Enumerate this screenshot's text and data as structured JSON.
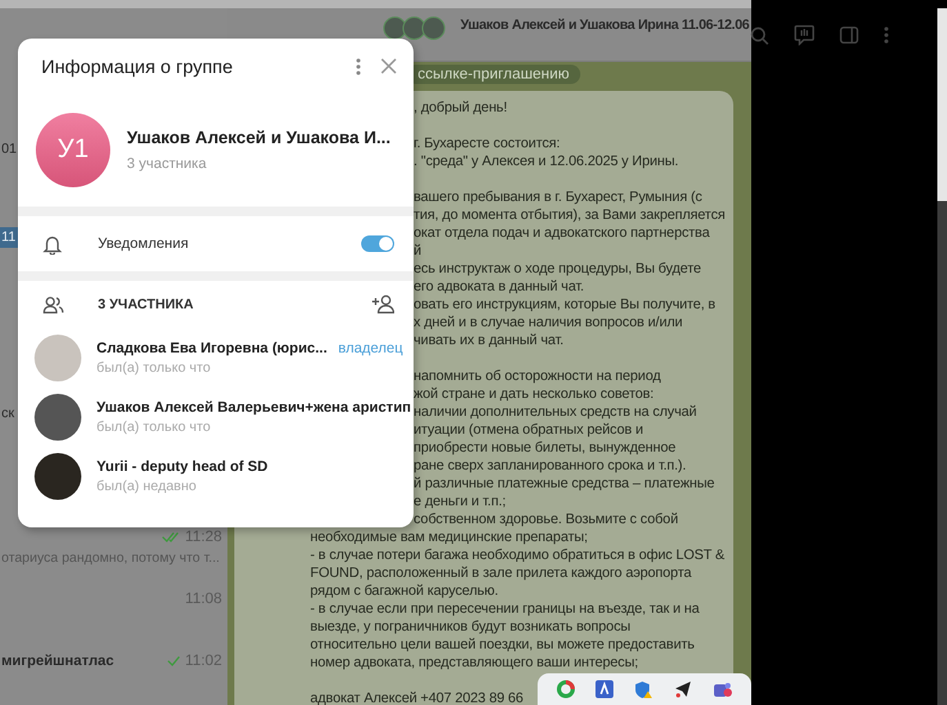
{
  "chat_list": {
    "edge_fragments": [
      {
        "text": "01",
        "selected": false
      },
      {
        "text": "11",
        "selected": true
      },
      {
        "text": "ск",
        "selected": false
      }
    ],
    "rows": [
      {
        "time": "11:28",
        "preview": "отариуса рандомно, потому что т...",
        "tick": true,
        "read": true
      },
      {
        "time": "11:08",
        "tick": false
      },
      {
        "name": "мигрейшнатлас",
        "time": "11:02",
        "tick": true,
        "read": false
      }
    ]
  },
  "chat": {
    "title": "Ушаков Алексей и Ушакова Ирина 11.06-12.06",
    "service_message": "ссылке-приглашению",
    "paragraphs_beside_panel": [
      [
        ", добрый день!"
      ],
      [
        "г. Бухаресте состоится:",
        ". \"среда\"  у Алексея и 12.06.2025 у Ирины."
      ],
      [
        "вашего пребывания в г. Бухарест, Румыния (с",
        "тия, до момента отбытия), за Вами закрепляется",
        "окат отдела подач и адвокатского партнерства",
        "й",
        "есь инструктаж о ходе процедуры, Вы будете",
        "его адвоката в данный чат.",
        "овать его инструкциям, которые Вы получите, в",
        "х дней и в случае наличия вопросов и/или",
        "чивать их в данный чат."
      ],
      [
        "напомнить об осторожности на период",
        "жой стране и дать несколько советов:",
        "наличии дополнительных средств на случай",
        "итуации (отмена обратных рейсов и",
        "приобрести новые билеты, вынужденное",
        "ране сверх запланированного срока и т.п.).",
        "й различные платежные средства – платежные",
        "е деньги и т.п.;",
        "собственном здоровье. Возьмите с собой"
      ]
    ],
    "paragraphs": [
      [
        "необходимые вам медицинские препараты;",
        "- в случае потери багажа необходимо обратиться в офис LOST &",
        "FOUND, расположенный в зале прилета каждого аэропорта",
        "рядом с багажной каруселью.",
        "- в случае если при пересечении границы на въезде, так и на",
        "выезде, у пограничников будут возникать вопросы",
        "относительно цели вашей поездки, вы можете предоставить",
        "номер адвоката, представляющего ваши интересы;"
      ],
      [
        "адвокат Алексей +407 2023 89 66"
      ]
    ]
  },
  "group_info": {
    "title": "Информация о группе",
    "avatar_text": "У1",
    "name": "Ушаков Алексей и Ушакова И...",
    "subtitle": "3 участника",
    "notifications": {
      "label": "Уведомления",
      "on": true
    },
    "members_header": "3 УЧАСТНИКА",
    "members": [
      {
        "name": "Сладкова Ева Игоревна (юрис...",
        "status": "был(а) только что",
        "role": "владелец"
      },
      {
        "name": "Ушаков Алексей Валерьевич+жена аристип",
        "status": "был(а) только что"
      },
      {
        "name": "Yurii - deputy head of SD",
        "status": "был(а) недавно"
      }
    ]
  },
  "tray": {
    "icons": [
      {
        "kind": "ring"
      },
      {
        "kind": "square"
      },
      {
        "kind": "shield"
      },
      {
        "kind": "plane"
      },
      {
        "kind": "people"
      }
    ]
  }
}
